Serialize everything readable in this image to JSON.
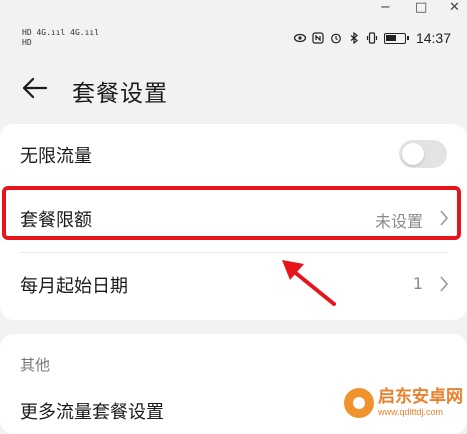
{
  "window": {
    "minimize": "−",
    "maximize": "□",
    "close": "✕"
  },
  "status_bar": {
    "signal_line1": "HD 4G.ııl 4G.ııl",
    "signal_line2": "HD",
    "icons": [
      "eye-icon",
      "nfc-icon",
      "alarm-icon",
      "bluetooth-icon",
      "vibrate-icon",
      "battery-icon"
    ],
    "time": "14:37"
  },
  "header": {
    "title": "套餐设置"
  },
  "settings": {
    "unlimited": {
      "label": "无限流量",
      "toggle_on": false
    },
    "plan_limit": {
      "label": "套餐限额",
      "value": "未设置"
    },
    "monthly_start": {
      "label": "每月起始日期",
      "value": "1"
    }
  },
  "other": {
    "section_label": "其他",
    "more_plans": "更多流量套餐设置"
  },
  "watermark": {
    "name": "启东安卓网",
    "url": "www.qdlttdj.com"
  },
  "colors": {
    "highlight": "#e8141b",
    "background": "#f2f2f2",
    "card": "#ffffff"
  }
}
